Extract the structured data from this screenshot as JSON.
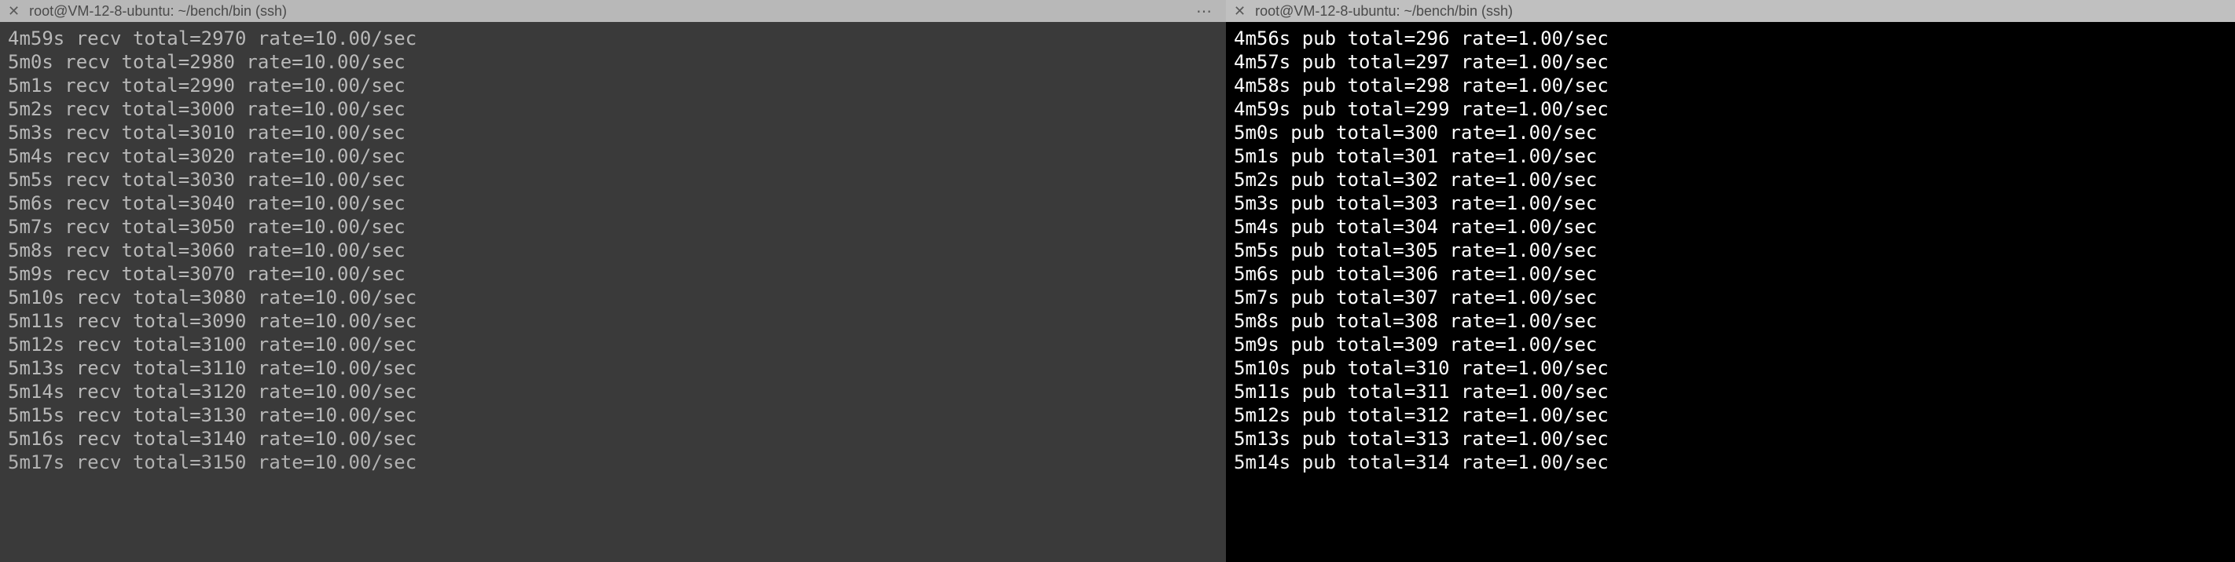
{
  "panes": {
    "left": {
      "tab_title": "root@VM-12-8-ubuntu: ~/bench/bin (ssh)",
      "lines": [
        "4m59s recv total=2970 rate=10.00/sec",
        "5m0s recv total=2980 rate=10.00/sec",
        "5m1s recv total=2990 rate=10.00/sec",
        "5m2s recv total=3000 rate=10.00/sec",
        "5m3s recv total=3010 rate=10.00/sec",
        "5m4s recv total=3020 rate=10.00/sec",
        "5m5s recv total=3030 rate=10.00/sec",
        "5m6s recv total=3040 rate=10.00/sec",
        "5m7s recv total=3050 rate=10.00/sec",
        "5m8s recv total=3060 rate=10.00/sec",
        "5m9s recv total=3070 rate=10.00/sec",
        "5m10s recv total=3080 rate=10.00/sec",
        "5m11s recv total=3090 rate=10.00/sec",
        "5m12s recv total=3100 rate=10.00/sec",
        "5m13s recv total=3110 rate=10.00/sec",
        "5m14s recv total=3120 rate=10.00/sec",
        "5m15s recv total=3130 rate=10.00/sec",
        "5m16s recv total=3140 rate=10.00/sec",
        "5m17s recv total=3150 rate=10.00/sec"
      ]
    },
    "right": {
      "tab_title": "root@VM-12-8-ubuntu: ~/bench/bin (ssh)",
      "lines": [
        "4m56s pub total=296 rate=1.00/sec",
        "4m57s pub total=297 rate=1.00/sec",
        "4m58s pub total=298 rate=1.00/sec",
        "4m59s pub total=299 rate=1.00/sec",
        "5m0s pub total=300 rate=1.00/sec",
        "5m1s pub total=301 rate=1.00/sec",
        "5m2s pub total=302 rate=1.00/sec",
        "5m3s pub total=303 rate=1.00/sec",
        "5m4s pub total=304 rate=1.00/sec",
        "5m5s pub total=305 rate=1.00/sec",
        "5m6s pub total=306 rate=1.00/sec",
        "5m7s pub total=307 rate=1.00/sec",
        "5m8s pub total=308 rate=1.00/sec",
        "5m9s pub total=309 rate=1.00/sec",
        "5m10s pub total=310 rate=1.00/sec",
        "5m11s pub total=311 rate=1.00/sec",
        "5m12s pub total=312 rate=1.00/sec",
        "5m13s pub total=313 rate=1.00/sec",
        "5m14s pub total=314 rate=1.00/sec"
      ]
    }
  },
  "icons": {
    "close_glyph": "✕",
    "ellipsis_glyph": "⋯"
  }
}
